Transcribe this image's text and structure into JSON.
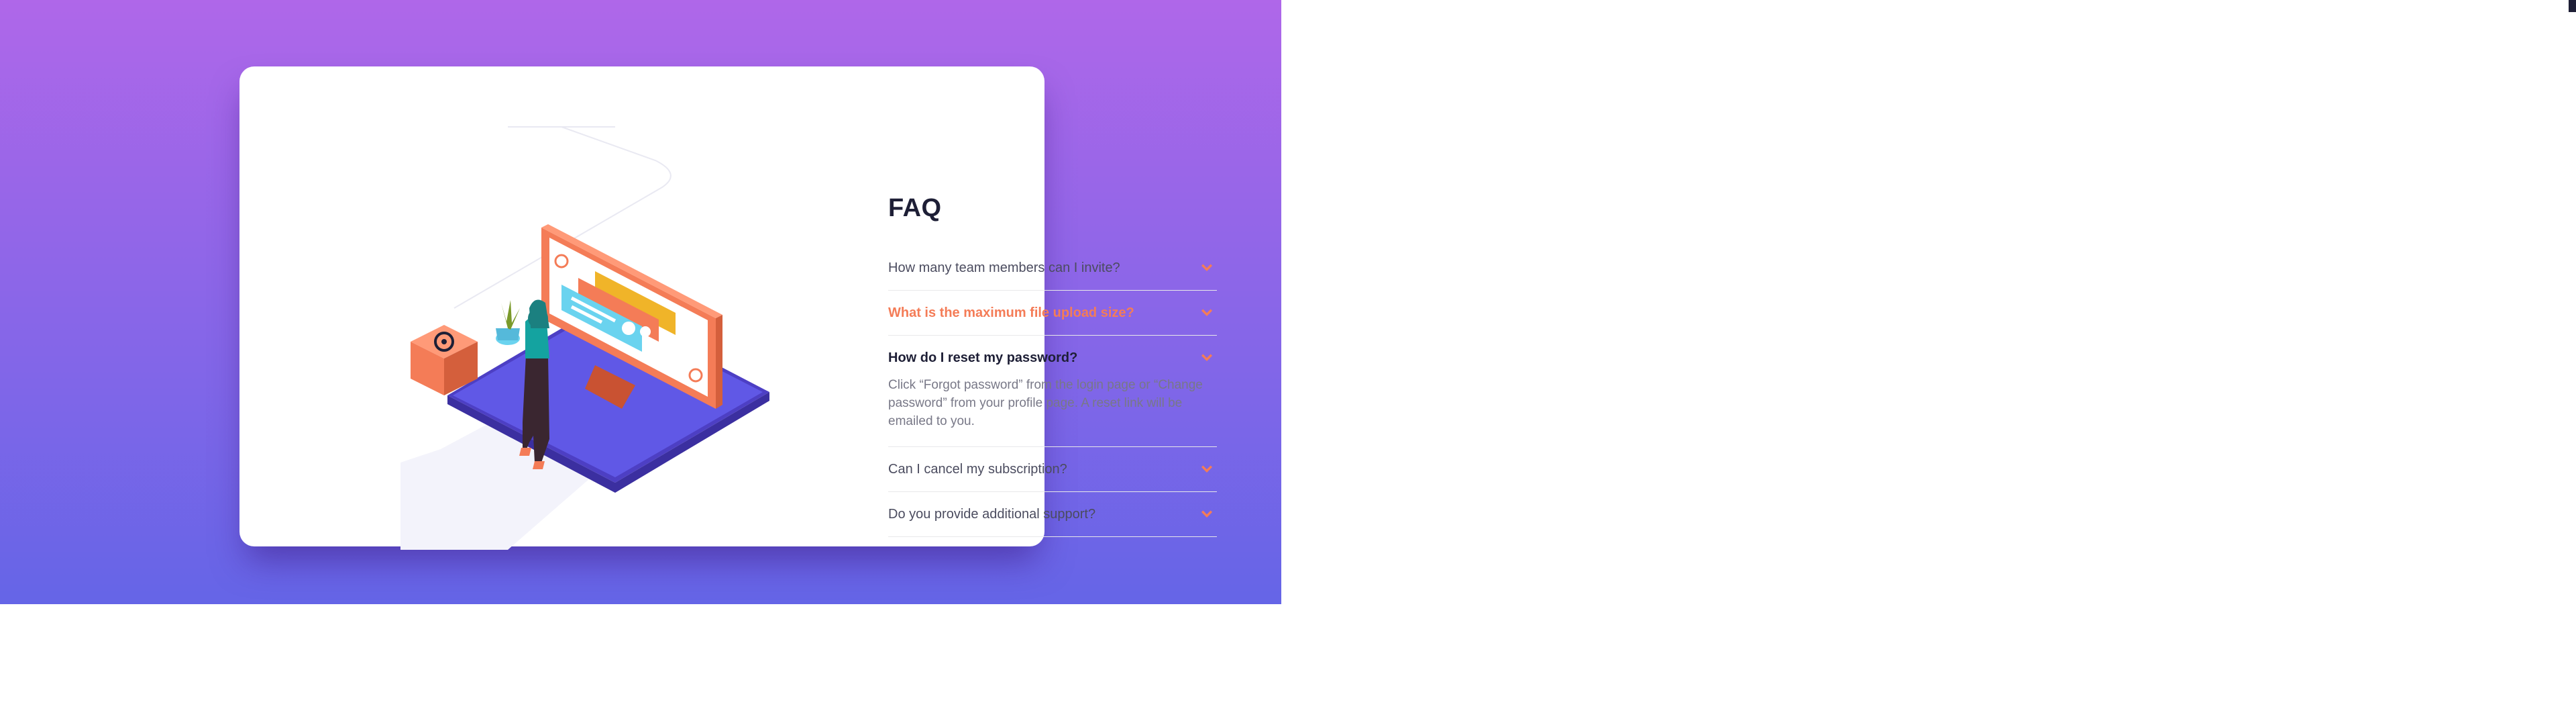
{
  "faq": {
    "title": "FAQ",
    "items": [
      {
        "question": "How many team members can I invite?",
        "state": "closed"
      },
      {
        "question": "What is the maximum file upload size?",
        "state": "hover"
      },
      {
        "question": "How do I reset my password?",
        "state": "open",
        "answer": "Click “Forgot password” from the login page or “Change password” from your profile page. A reset link will be emailed to you."
      },
      {
        "question": "Can I cancel my subscription?",
        "state": "closed"
      },
      {
        "question": "Do you provide additional support?",
        "state": "closed"
      }
    ]
  },
  "colors": {
    "gradient_top": "#af67e9",
    "gradient_bottom": "#6565e7",
    "accent": "#f47c57",
    "title": "#1e1f36",
    "text": "#4b4c5f",
    "answer_text": "#787887"
  },
  "icons": {
    "chevron": "chevron-down-icon",
    "illustration": "woman-online-illustration"
  }
}
